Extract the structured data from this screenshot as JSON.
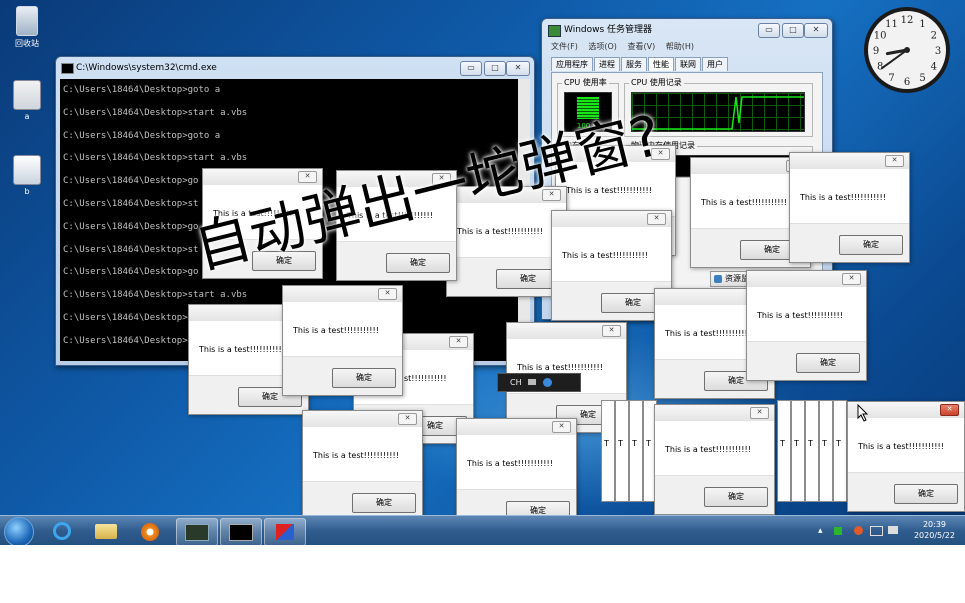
{
  "desktop": {
    "icons": [
      {
        "label": "回收站"
      },
      {
        "label": "a"
      },
      {
        "label": "b"
      }
    ]
  },
  "cmd": {
    "title": "C:\\Windows\\system32\\cmd.exe",
    "lines": [
      "C:\\Users\\18464\\Desktop>goto a",
      "C:\\Users\\18464\\Desktop>start a.vbs",
      "C:\\Users\\18464\\Desktop>goto a",
      "C:\\Users\\18464\\Desktop>start a.vbs",
      "C:\\Users\\18464\\Desktop>go",
      "C:\\Users\\18464\\Desktop>st",
      "C:\\Users\\18464\\Desktop>go",
      "C:\\Users\\18464\\Desktop>st",
      "C:\\Users\\18464\\Desktop>go",
      "C:\\Users\\18464\\Desktop>start a.vbs",
      "C:\\Users\\18464\\Desktop>",
      "C:\\Users\\18464\\Desktop>"
    ]
  },
  "taskmgr": {
    "title": "Windows 任务管理器",
    "menu": [
      "文件(F)",
      "选项(O)",
      "查看(V)",
      "帮助(H)"
    ],
    "tabs": [
      "应用程序",
      "进程",
      "服务",
      "性能",
      "联网",
      "用户"
    ],
    "active_tab": "性能",
    "cpu_usage_label": "CPU 使用率",
    "cpu_usage_value": "100 %",
    "cpu_usage_fraction": 1.0,
    "cpu_history_label": "CPU 使用记录",
    "memory_label": "内存",
    "memory_history_label": "物理内存使用记录",
    "resource_button": "资源监"
  },
  "msgbox": {
    "message": "This is a test!!!!!!!!!!!",
    "ok_label": "确定",
    "close_glyph": "✕",
    "partial_message": "st!!!!!!!!!!!",
    "strip_glyph": "T"
  },
  "caption": "自动弹出一坨弹窗?",
  "ime": {
    "label": "CH"
  },
  "clock": {
    "numerals": [
      "12",
      "1",
      "2",
      "3",
      "4",
      "5",
      "6",
      "7",
      "8",
      "9",
      "10",
      "11"
    ],
    "time_hours": 20.65
  },
  "tray": {
    "time": "20:39",
    "date": "2020/5/22"
  },
  "colors": {
    "cmd_bg": "#000000",
    "graph_green": "#19e51a",
    "wallpaper": "#0f5aa8"
  }
}
